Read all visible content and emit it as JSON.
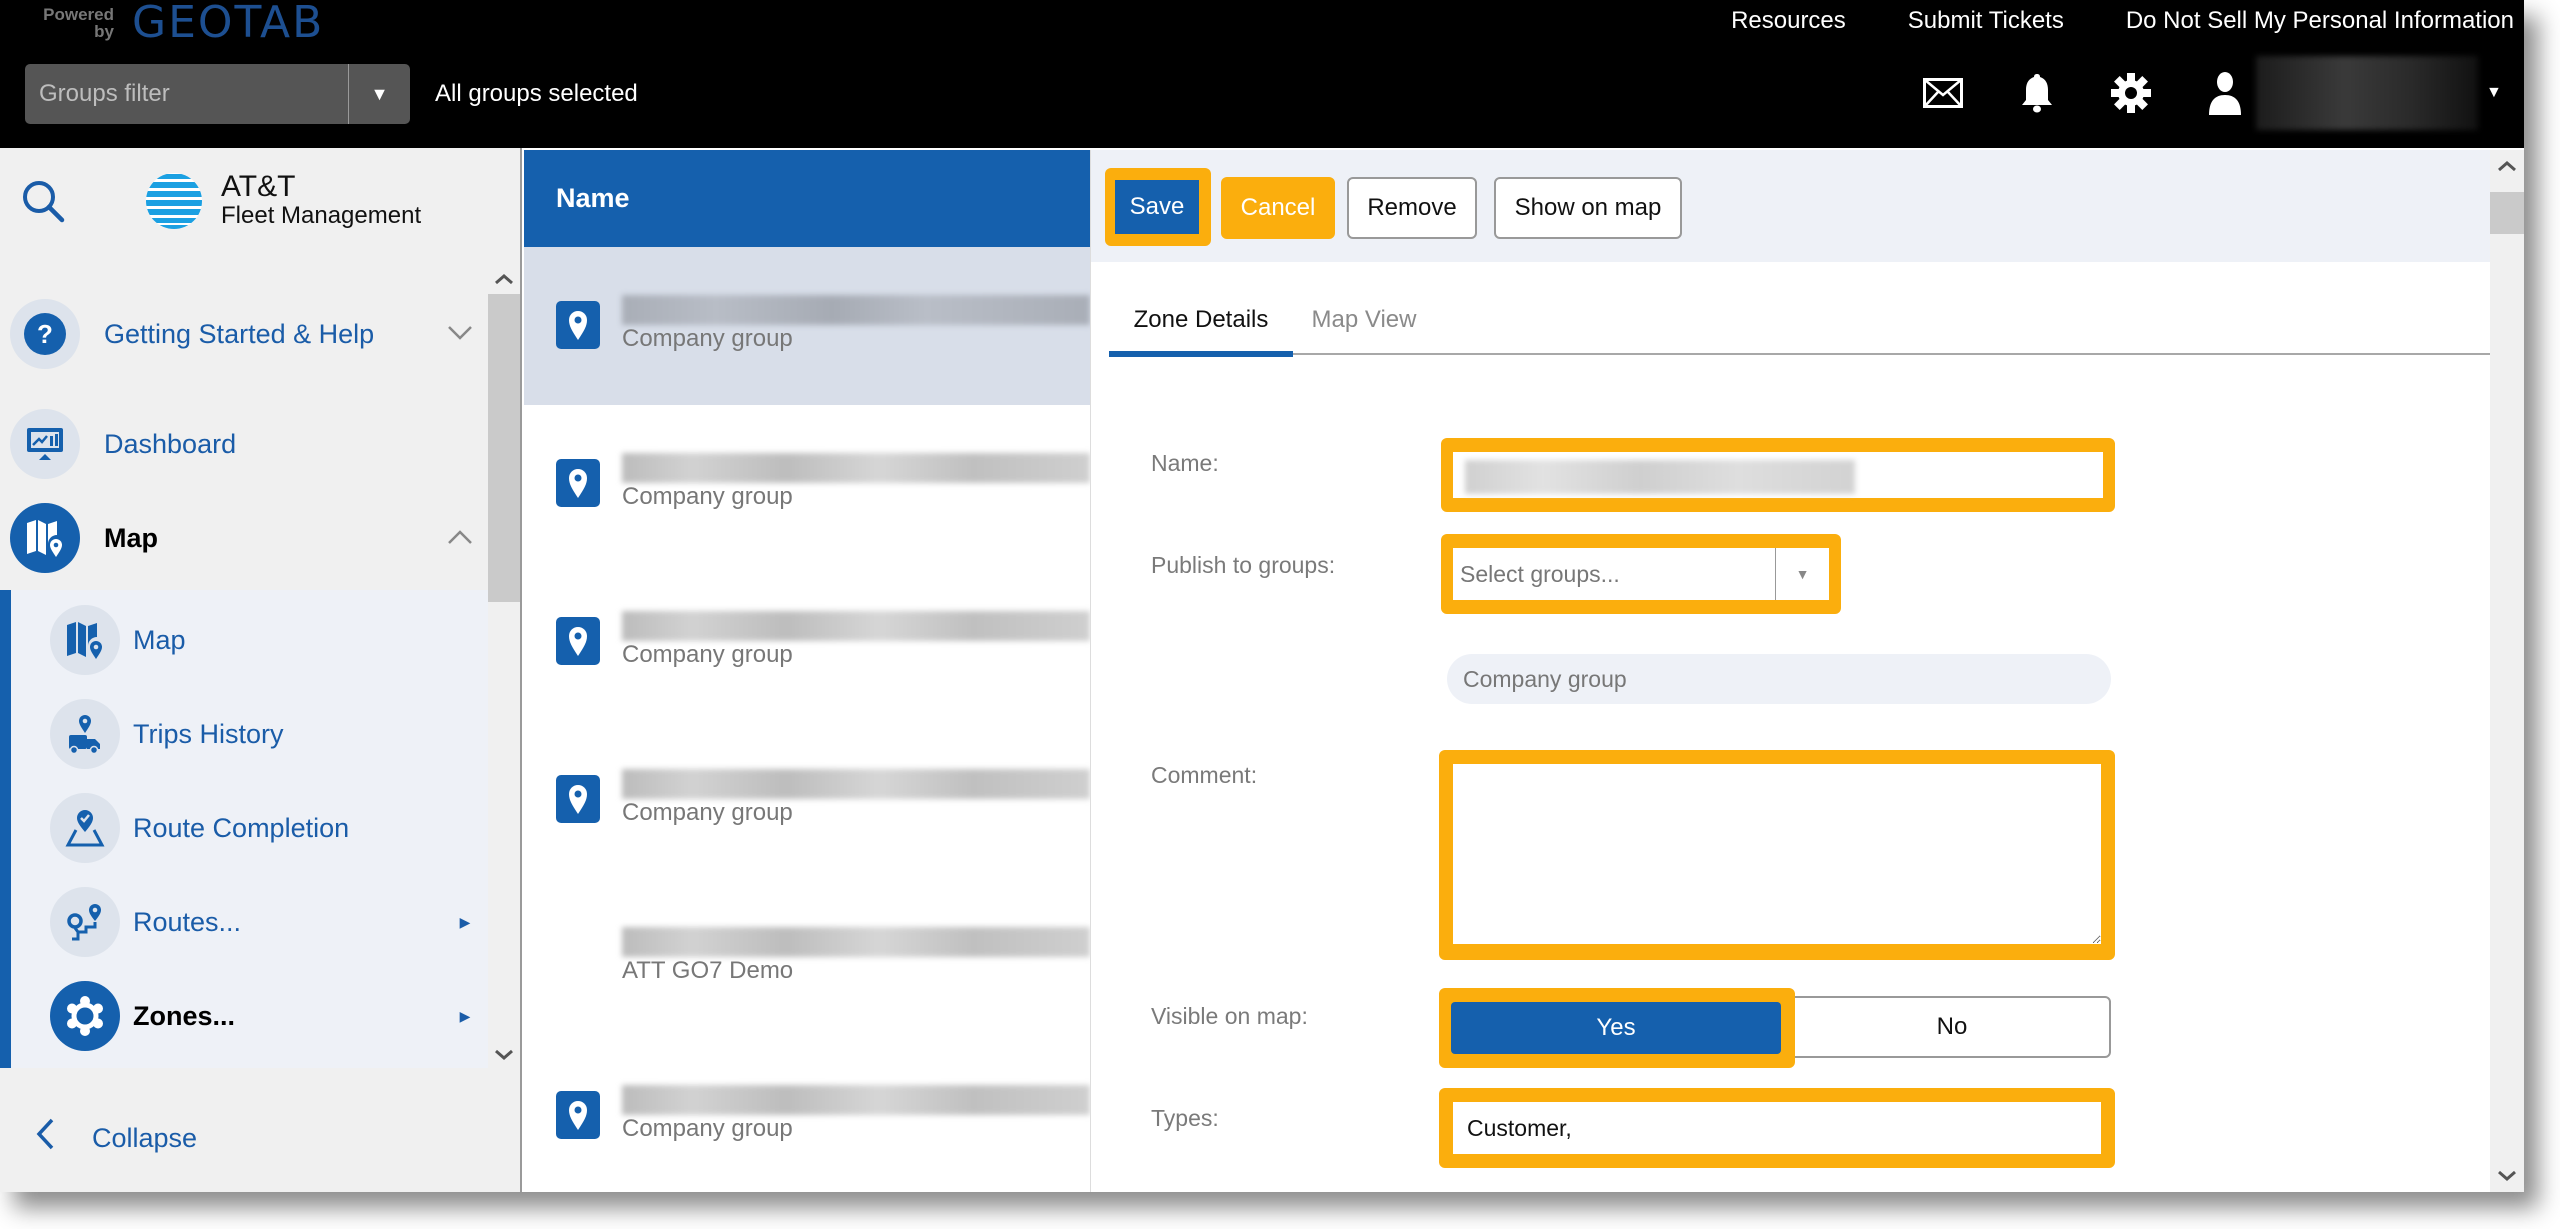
{
  "topbar": {
    "powered_by": "Powered by",
    "brand": "GEOTAB",
    "groups_filter_placeholder": "Groups filter",
    "groups_status": "All groups selected",
    "links": [
      "Resources",
      "Submit Tickets",
      "Do Not Sell My Personal Information"
    ],
    "icons": [
      "mail-icon",
      "bell-icon",
      "gear-icon",
      "user-icon"
    ]
  },
  "sidebar": {
    "logo_line1": "AT&T",
    "logo_line2": "Fleet Management",
    "items": [
      {
        "label": "Getting Started & Help",
        "icon": "help-icon",
        "expand": "chevron-down"
      },
      {
        "label": "Dashboard",
        "icon": "dashboard-icon"
      },
      {
        "label": "Map",
        "icon": "map-icon",
        "expand": "chevron-up",
        "active": true
      }
    ],
    "sub_items": [
      {
        "label": "Map",
        "icon": "map-icon"
      },
      {
        "label": "Trips History",
        "icon": "trips-history-icon"
      },
      {
        "label": "Route Completion",
        "icon": "route-completion-icon"
      },
      {
        "label": "Routes...",
        "icon": "routes-icon",
        "has_submenu": true
      },
      {
        "label": "Zones...",
        "icon": "zones-icon",
        "has_submenu": true,
        "active": true
      }
    ],
    "collapse_label": "Collapse"
  },
  "list": {
    "header": "Name",
    "rows": [
      {
        "name": "[redacted]",
        "group": "Company group",
        "selected": true,
        "has_icon": true
      },
      {
        "name": "[redacted]",
        "group": "Company group",
        "has_icon": true
      },
      {
        "name": "[redacted]",
        "group": "Company group",
        "has_icon": true
      },
      {
        "name": "[redacted]",
        "group": "Company group",
        "has_icon": true
      },
      {
        "name": "[redacted]",
        "group": "ATT GO7 Demo",
        "has_icon": false
      },
      {
        "name": "[redacted]",
        "group": "Company group",
        "has_icon": true
      }
    ]
  },
  "detail": {
    "toolbar": {
      "save": "Save",
      "cancel": "Cancel",
      "remove": "Remove",
      "show_on_map": "Show on map"
    },
    "tabs": [
      {
        "label": "Zone Details",
        "active": true
      },
      {
        "label": "Map View",
        "active": false
      }
    ],
    "form": {
      "name_label": "Name:",
      "name_value": "[redacted]",
      "publish_label": "Publish to groups:",
      "publish_placeholder": "Select groups...",
      "selected_group": "Company group",
      "comment_label": "Comment:",
      "comment_value": "",
      "visible_label": "Visible on map:",
      "visible_yes": "Yes",
      "visible_no": "No",
      "visible_selected": "Yes",
      "types_label": "Types:",
      "types_value": "Customer,"
    }
  },
  "colors": {
    "brand_blue": "#1560ad",
    "highlight_orange": "#fbae0d",
    "topbar_bg": "#000000"
  }
}
